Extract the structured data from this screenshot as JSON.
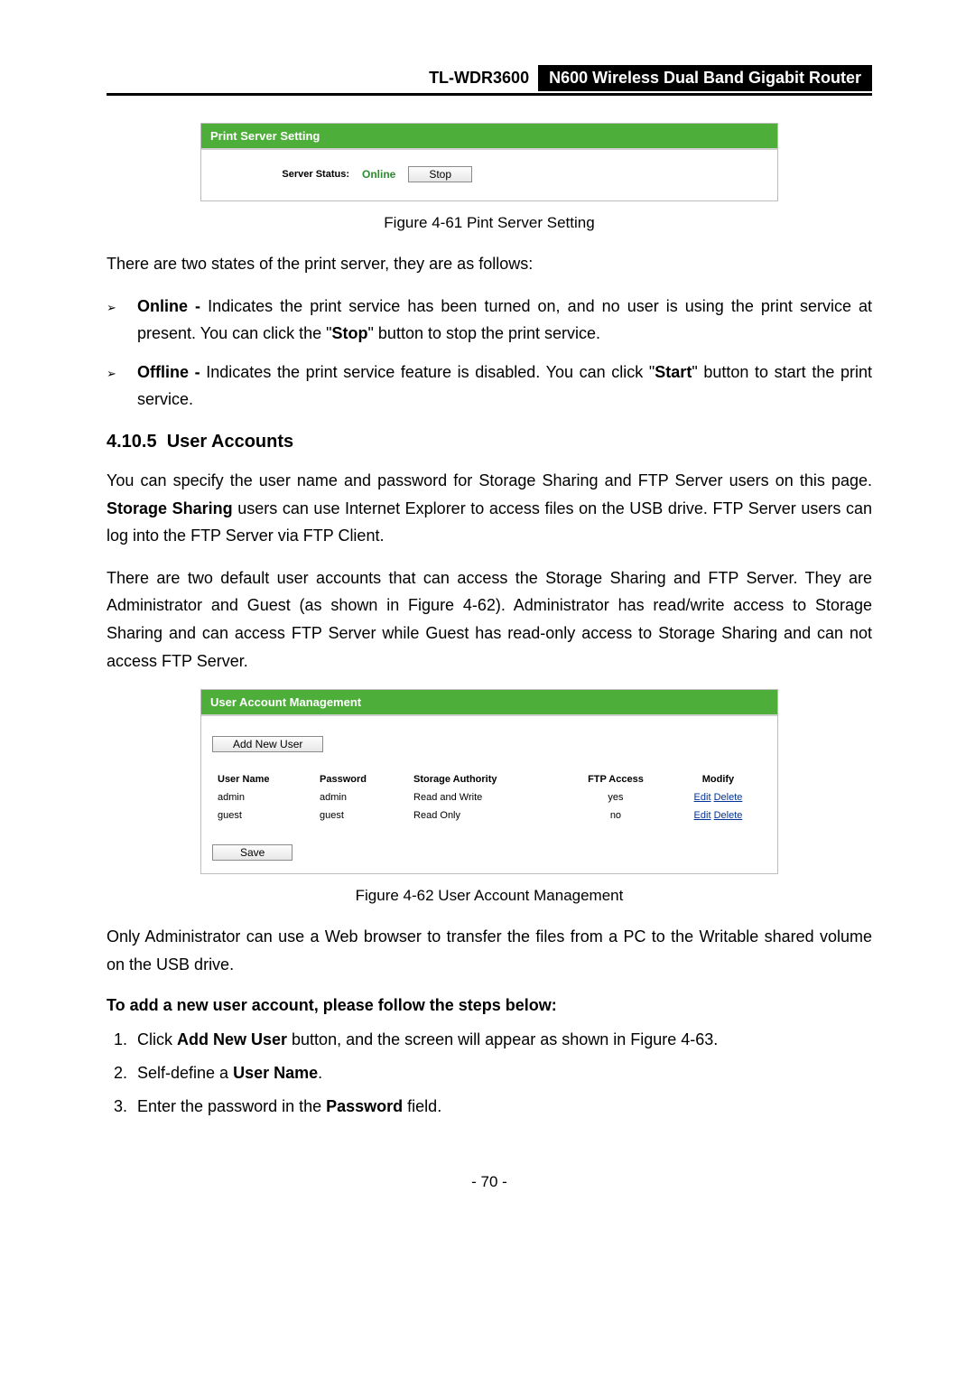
{
  "header": {
    "model": "TL-WDR3600",
    "title": "N600 Wireless Dual Band Gigabit Router"
  },
  "panel1": {
    "title": "Print Server Setting",
    "server_status_label": "Server Status:",
    "server_status_value": "Online",
    "stop_btn": "Stop"
  },
  "caption1": "Figure 4-61 Pint Server Setting",
  "intro_states": "There are two states of the print server, they are as follows:",
  "bullets": {
    "online_bold": "Online -",
    "online_rest_1": " Indicates the print service has been turned on, and no user is using the print service at present. You can click the \"",
    "online_stop": "Stop",
    "online_rest_2": "\" button to stop the print service.",
    "offline_bold": "Offline -",
    "offline_rest_1": " Indicates the print service feature is disabled. You can click \"",
    "offline_start": "Start",
    "offline_rest_2": "\" button to start the print service."
  },
  "section_num": "4.10.5",
  "section_title": "User Accounts",
  "para_ua_1a": "You can specify the user name and password for Storage Sharing and FTP Server users on this page. ",
  "para_ua_1b": "Storage Sharing",
  "para_ua_1c": " users can use Internet Explorer to access files on the USB drive. FTP Server users can log into the FTP Server via FTP Client.",
  "para_ua_2": "There are two default user accounts that can access the Storage Sharing and FTP Server. They are Administrator and Guest (as shown in Figure 4-62). Administrator has read/write access to Storage Sharing and can access FTP Server while Guest has read-only access to Storage Sharing and can not access FTP Server.",
  "panel2": {
    "title": "User Account Management",
    "add_btn": "Add New User",
    "cols": {
      "uname": "User Name",
      "pwd": "Password",
      "auth": "Storage Authority",
      "ftp": "FTP Access",
      "mod": "Modify"
    },
    "rows": [
      {
        "uname": "admin",
        "pwd": "admin",
        "auth": "Read and Write",
        "ftp": "yes",
        "edit": "Edit",
        "del": "Delete"
      },
      {
        "uname": "guest",
        "pwd": "guest",
        "auth": "Read Only",
        "ftp": "no",
        "edit": "Edit",
        "del": "Delete"
      }
    ],
    "save_btn": "Save"
  },
  "caption2": "Figure 4-62 User Account Management",
  "para_ua_3": "Only Administrator can use a Web browser to transfer the files from a PC to the Writable shared volume on the USB drive.",
  "steps_intro": "To add a new user account, please follow the steps below:",
  "steps": {
    "s1a": "Click ",
    "s1b": "Add New User",
    "s1c": " button, and the screen will appear as shown in Figure 4-63.",
    "s2a": "Self-define a ",
    "s2b": "User Name",
    "s2c": ".",
    "s3a": "Enter the password in the ",
    "s3b": "Password",
    "s3c": " field."
  },
  "page_number": "- 70 -"
}
